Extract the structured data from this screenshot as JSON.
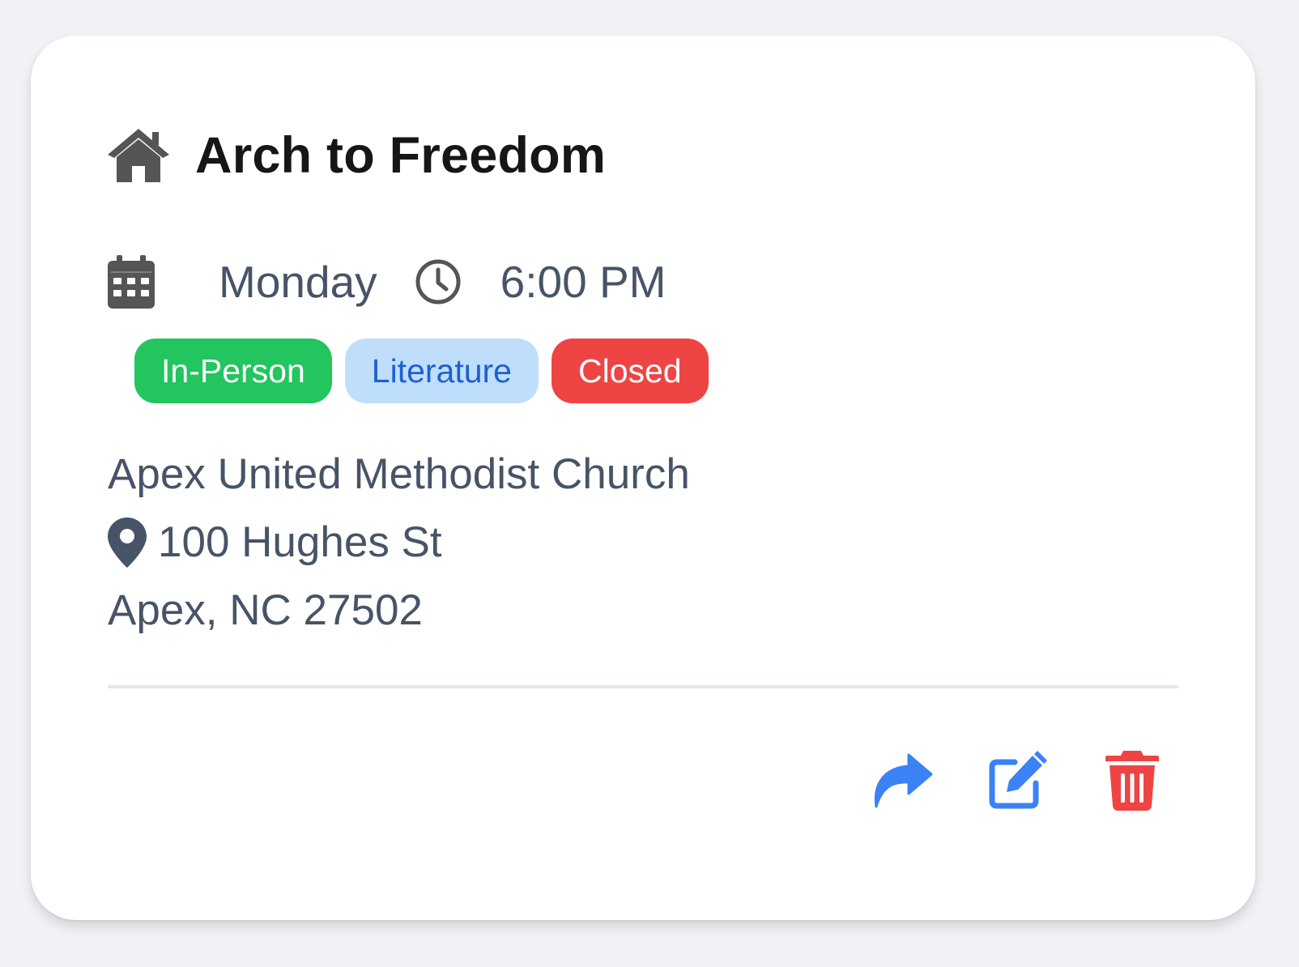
{
  "meeting": {
    "title": "Arch to Freedom",
    "day": "Monday",
    "time": "6:00 PM",
    "badges": [
      {
        "label": "In-Person",
        "color": "#22c55e"
      },
      {
        "label": "Literature",
        "color": "#bfdefb"
      },
      {
        "label": "Closed",
        "color": "#ef4444"
      }
    ],
    "location": {
      "name": "Apex United Methodist Church",
      "street": "100 Hughes St",
      "city_line": "Apex, NC 27502"
    }
  },
  "icons": {
    "title_icon": "home-icon",
    "day_icon": "calendar-icon",
    "time_icon": "clock-icon",
    "address_icon": "map-pin-icon"
  },
  "actions": [
    {
      "name": "share",
      "icon": "share-icon",
      "color": "#3b82f6"
    },
    {
      "name": "edit",
      "icon": "edit-icon",
      "color": "#3b82f6"
    },
    {
      "name": "delete",
      "icon": "trash-icon",
      "color": "#ef4444"
    }
  ]
}
